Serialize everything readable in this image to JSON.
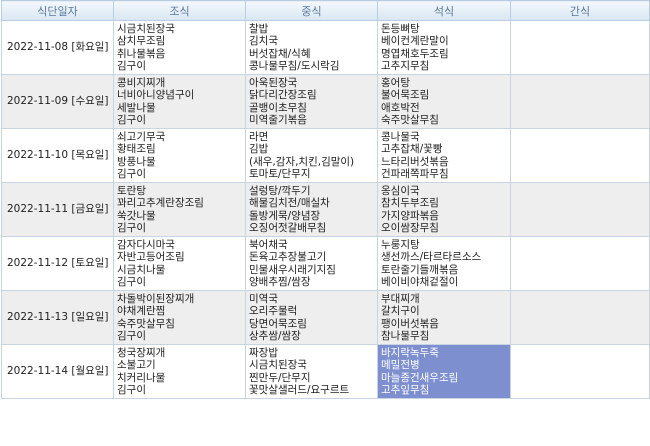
{
  "headers": [
    "식단일자",
    "조식",
    "중식",
    "석식",
    "간식"
  ],
  "rows": [
    {
      "date": "2022-11-08 [화요일]",
      "breakfast": [
        "시금치된장국",
        "삼치무조림",
        "취나물볶음",
        "김구이"
      ],
      "lunch": [
        "찰밥",
        "김치국",
        "버섯잡채/식혜",
        "콩나물무침/도시락김"
      ],
      "dinner": [
        "돈등뼈탕",
        "베이컨계란말이",
        "명엽채호두조림",
        "고추지무침"
      ],
      "snack": []
    },
    {
      "date": "2022-11-09 [수요일]",
      "breakfast": [
        "콩비지찌개",
        "너비아니양념구이",
        "세발나물",
        "김구이"
      ],
      "lunch": [
        "아욱된장국",
        "닭다리간장조림",
        "골뱅이초무침",
        "미역줄기볶음"
      ],
      "dinner": [
        "홍어탕",
        "불어묵조림",
        "애호박전",
        "숙주맛살무침"
      ],
      "snack": []
    },
    {
      "date": "2022-11-10 [목요일]",
      "breakfast": [
        "쇠고기무국",
        "황태조림",
        "방풍나물",
        "김구이"
      ],
      "lunch": [
        "라면",
        "김밥",
        "(새우,감자,치킨,김말이)",
        "토마토/단무지"
      ],
      "dinner": [
        "콩나물국",
        "고추잡채/꽃빵",
        "느타리버섯볶음",
        "건파래쪽파무침"
      ],
      "snack": []
    },
    {
      "date": "2022-11-11 [금요일]",
      "breakfast": [
        "토란탕",
        "꽈리고추계란장조림",
        "쑥갓나물",
        "김구이"
      ],
      "lunch": [
        "설렁탕/깍두기",
        "해물김치전/매실차",
        "돌방게묵/양념장",
        "오징어젓갈배무침"
      ],
      "dinner": [
        "옹심이국",
        "참치두부조림",
        "가지양파볶음",
        "오이쌈장무침"
      ],
      "snack": []
    },
    {
      "date": "2022-11-12 [토요일]",
      "breakfast": [
        "감자다시마국",
        "자반고등어조림",
        "시금치나물",
        "김구이"
      ],
      "lunch": [
        "북어채국",
        "돈육고추장불고기",
        "민물새우시래기지짐",
        "양배추찜/쌈장"
      ],
      "dinner": [
        "누룽지탕",
        "생선까스/타르타르소스",
        "토란줄기들깨볶음",
        "베이비야채겉절이"
      ],
      "snack": []
    },
    {
      "date": "2022-11-13 [일요일]",
      "breakfast": [
        "차돌박이된장찌개",
        "야채계란찜",
        "숙주맛살무침",
        "김구이"
      ],
      "lunch": [
        "미역국",
        "오리주물럭",
        "당면어묵조림",
        "상추쌈/쌈장"
      ],
      "dinner": [
        "부대찌개",
        "갈치구이",
        "팽이버섯볶음",
        "참나물무침"
      ],
      "snack": []
    },
    {
      "date": "2022-11-14 [월요일]",
      "breakfast": [
        "청국장찌개",
        "소불고기",
        "치커리나물",
        "김구이"
      ],
      "lunch": [
        "짜장밥",
        "시금치된장국",
        "찐만두/단무지",
        "꽃맛살샐러드/요구르트"
      ],
      "dinner": [
        "바지락녹두죽",
        "메밀전병",
        "마늘종건새우조림",
        "고추잎무침"
      ],
      "snack": []
    }
  ],
  "colors": {
    "header_text": "#5c7a9c",
    "alt_row": "#eeeeee",
    "selected_cell": "#7e8fd0"
  },
  "selected": {
    "row": 6,
    "column": "dinner"
  }
}
